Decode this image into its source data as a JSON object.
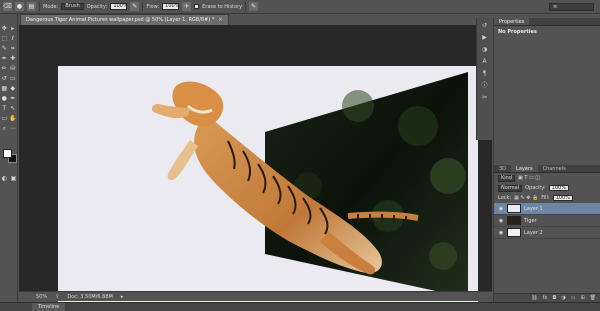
{
  "options_bar": {
    "mode_label": "Mode:",
    "mode_value": "Brush",
    "opacity_label": "Opacity:",
    "opacity_value": "100%",
    "flow_label": "Flow:",
    "flow_value": "100%",
    "erase_history_label": "Erase to History"
  },
  "document": {
    "tab_title": "Dangerous Tiger Animal Pictures wallpaper.psd @ 50% (Layer 1, RGB/8#) *",
    "close_glyph": "×"
  },
  "status": {
    "zoom": "50%",
    "doc_size": "Doc: 3.50M/6.88M"
  },
  "timeline": {
    "label": "Timeline"
  },
  "properties_panel": {
    "tab_label": "Properties",
    "body_title": "No Properties"
  },
  "layers_panel": {
    "tabs": [
      "3D",
      "Layers",
      "Channels"
    ],
    "active_tab": "Layers",
    "kind_label": "Kind",
    "blend_mode": "Normal",
    "opacity_label": "Opacity:",
    "opacity_value": "100%",
    "lock_label": "Lock:",
    "fill_label": "Fill:",
    "fill_value": "100%",
    "layers": [
      {
        "name": "Layer 1",
        "selected": true
      },
      {
        "name": "Tiger",
        "selected": false
      },
      {
        "name": "Layer 2",
        "selected": false
      }
    ]
  },
  "colors": {
    "accent_selection": "#6f85a6",
    "ui_background": "#535353",
    "workarea": "#282828",
    "canvas": "#eaeaf0"
  }
}
